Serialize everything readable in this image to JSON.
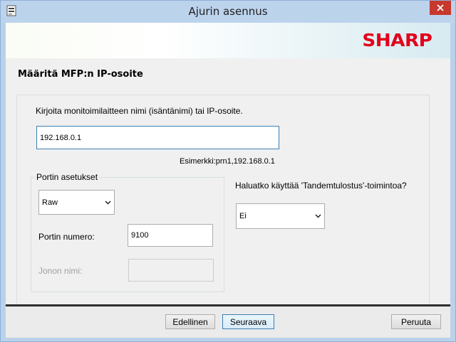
{
  "window": {
    "title": "Ajurin asennus"
  },
  "brand": {
    "logo_text": "SHARP",
    "color": "#e3001b"
  },
  "page": {
    "heading": "Määritä MFP:n IP-osoite",
    "instruction": "Kirjoita monitoimilaitteen nimi (isäntänimi) tai IP-osoite.",
    "address_value": "192.168.0.1",
    "example": "Esimerkki:prn1,192.168.0.1"
  },
  "port_settings": {
    "legend": "Portin asetukset",
    "protocol_selected": "Raw",
    "port_number_label": "Portin numero:",
    "port_number_value": "9100",
    "queue_name_label": "Jonon nimi:",
    "queue_name_value": ""
  },
  "tandem": {
    "question": "Haluatko käyttää 'Tandemtulostus'-toimintoa?",
    "selected": "Ei"
  },
  "buttons": {
    "back": "Edellinen",
    "next": "Seuraava",
    "cancel": "Peruuta"
  }
}
